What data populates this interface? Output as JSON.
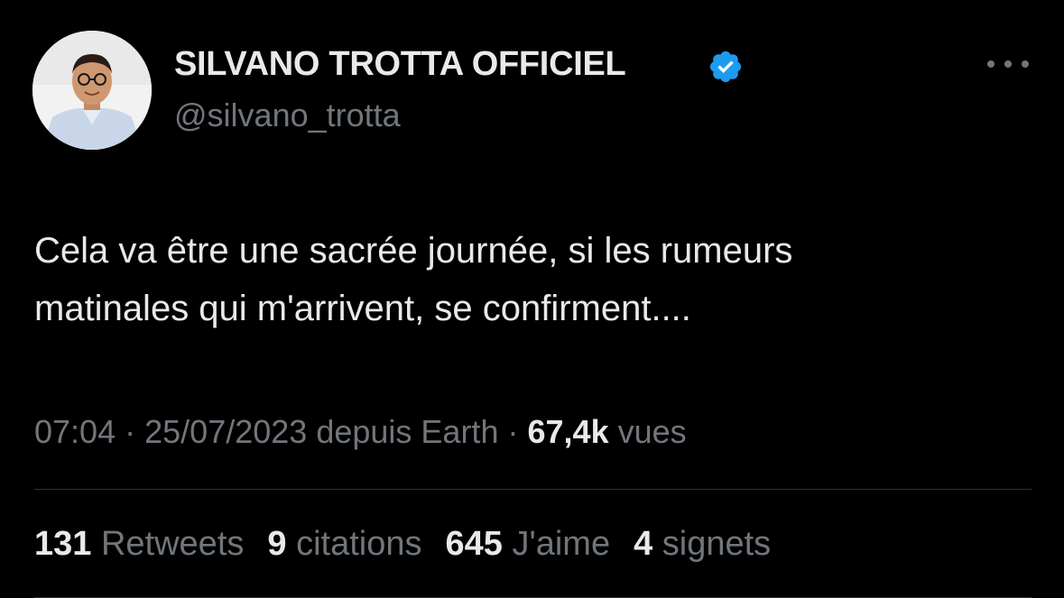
{
  "author": {
    "display_name": "SILVANO TROTTA OFFICIEL",
    "handle": "@silvano_trotta",
    "verified": true,
    "avatar_icon": "profile-photo"
  },
  "tweet": {
    "text_lines": [
      "Cela va être une sacrée journée, si les rumeurs",
      "matinales qui m'arrivent, se confirment...."
    ],
    "time": "07:04",
    "separator": "·",
    "date": "25/07/2023",
    "source": "depuis Earth",
    "views_count": "67,4k",
    "views_label": "vues"
  },
  "stats": {
    "retweets": {
      "count": "131",
      "label": "Retweets"
    },
    "quotes": {
      "count": "9",
      "label": "citations"
    },
    "likes": {
      "count": "645",
      "label": "J'aime"
    },
    "bookmarks": {
      "count": "4",
      "label": "signets"
    }
  },
  "colors": {
    "background": "#000000",
    "primary_text": "#e7e9ea",
    "secondary_text": "#71767b",
    "verified_blue": "#1d9bf0",
    "divider": "#2f3336"
  }
}
